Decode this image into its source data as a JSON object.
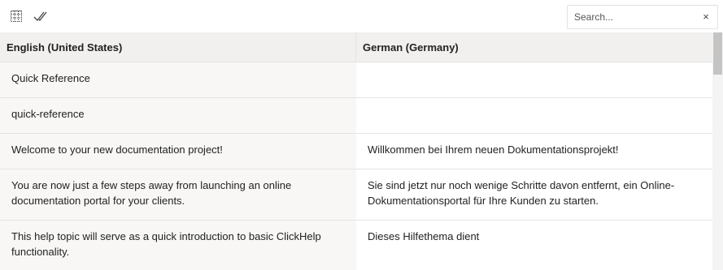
{
  "toolbar": {
    "icon1": "grid-settings-icon",
    "icon2": "double-check-icon",
    "search": {
      "value": "",
      "placeholder": "Search...",
      "clear_label": "×"
    }
  },
  "grid": {
    "headers": {
      "source": "English (United States)",
      "target": "German (Germany)"
    },
    "rows": [
      {
        "source": "Quick Reference",
        "target": ""
      },
      {
        "source": "quick-reference",
        "target": ""
      },
      {
        "source": "Welcome to your new documentation project!",
        "target": "Willkommen bei Ihrem neuen Dokumentationsprojekt!"
      },
      {
        "source": "You are now just a few steps away from launching an online documentation portal for your clients.",
        "target": "Sie sind jetzt nur noch wenige Schritte davon entfernt, ein Online-Dokumentationsportal für Ihre Kunden zu starten."
      },
      {
        "source": "This help topic will serve as a quick introduction to basic ClickHelp functionality.",
        "target": "Dieses Hilfethema dient"
      }
    ]
  },
  "colors": {
    "header_bg": "#f1f0ef",
    "source_cell_bg": "#f8f7f6",
    "border": "#e6e4e2",
    "scroll_thumb": "#c4c4c4"
  }
}
